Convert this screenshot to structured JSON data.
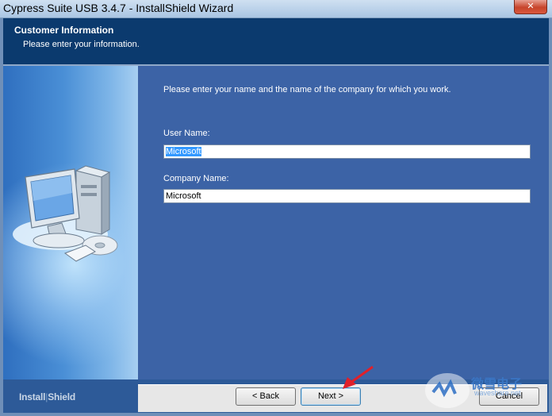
{
  "window": {
    "title": "Cypress Suite USB 3.4.7 - InstallShield Wizard"
  },
  "header": {
    "title": "Customer Information",
    "subtitle": "Please enter your information."
  },
  "form": {
    "intro": "Please enter your name and the name of the company for which you work.",
    "user_name_label": "User Name:",
    "user_name_value": "Microsoft",
    "company_name_label": "Company Name:",
    "company_name_value": "Microsoft"
  },
  "footer": {
    "brand_left": "Install",
    "brand_sep": "|",
    "brand_right": "Shield",
    "back_label": "< Back",
    "next_label": "Next >",
    "cancel_label": "Cancel"
  },
  "watermark": {
    "text": "微雪电子",
    "url": "waveshare.net"
  },
  "colors": {
    "header": "#0b3a6e",
    "content": "#3c63a6",
    "arrow": "#e0202a"
  }
}
